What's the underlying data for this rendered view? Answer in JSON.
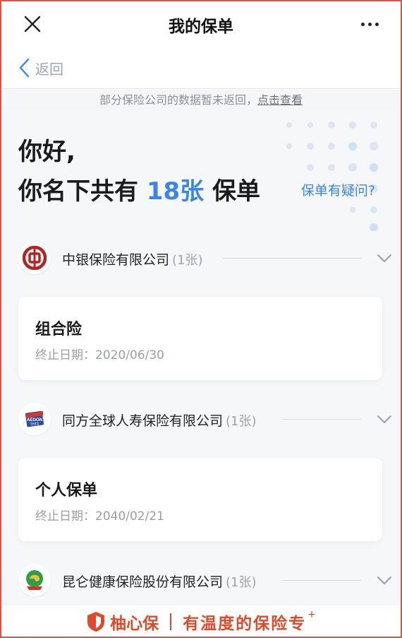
{
  "header": {
    "title": "我的保单",
    "back_label": "返回"
  },
  "notice": {
    "text": "部分保险公司的数据暂未返回，",
    "link": "点击查看"
  },
  "greeting": {
    "line1": "你好,",
    "prefix": "你名下共有",
    "count": "18张",
    "suffix": "保单",
    "question": "保单有疑问?"
  },
  "companies": [
    {
      "name": "中银保险有限公司",
      "count": "(1张)",
      "policy_title": "组合险",
      "policy_date": "终止日期：2020/06/30"
    },
    {
      "name": "同方全球人寿保险有限公司",
      "count": "(1张)",
      "logo_text_1": "AEGON",
      "logo_text_2": "THTF",
      "policy_title": "个人保单",
      "policy_date": "终止日期：2040/02/21"
    },
    {
      "name": "昆仑健康保险股份有限公司",
      "count": "(1张)"
    }
  ],
  "footer": {
    "brand": "柚心保",
    "slogan": "有温度的保险专",
    "plus": "+"
  },
  "colors": {
    "accent": "#3a86e8",
    "brand": "#e2492b",
    "boc_red": "#b5241f"
  }
}
